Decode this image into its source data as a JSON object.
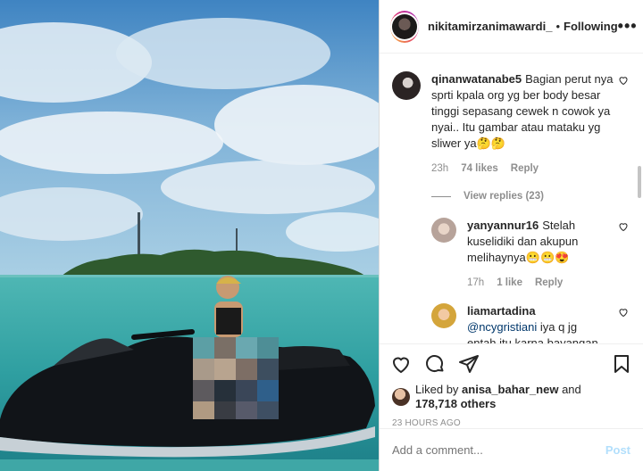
{
  "header": {
    "username": "nikitamirzanimawardi_",
    "dot": "•",
    "follow_state": "Following",
    "more": "•••"
  },
  "comments": [
    {
      "username": "qinanwatanabe5",
      "text": "Bagian perut nya sprti kpala org yg ber body besar tinggi sepasang cewek n cowok ya nyai.. Itu gambar atau mataku yg sliwer ya🤔🤔",
      "time": "23h",
      "likes": "74 likes",
      "reply_label": "Reply",
      "view_replies": "View replies (23)"
    },
    {
      "username": "yanyannur16",
      "text": "Stelah kuselidiki dan akupun melihaynya😬😬😍",
      "time": "17h",
      "likes": "1 like",
      "reply_label": "Reply"
    },
    {
      "username": "liamartadina",
      "mention": "@ncygristiani",
      "text": "iya q jg entah itu karna bayangan atau apa yg"
    }
  ],
  "likes": {
    "prefix": "Liked by",
    "user": "anisa_bahar_new",
    "and": "and",
    "count": "178,718 others"
  },
  "timeago": "23 HOURS AGO",
  "add_comment": {
    "placeholder": "Add a comment...",
    "post_label": "Post"
  },
  "colors": {
    "link": "#00376b",
    "muted": "#8e8e8e",
    "post_disabled": "#b2dffc"
  }
}
